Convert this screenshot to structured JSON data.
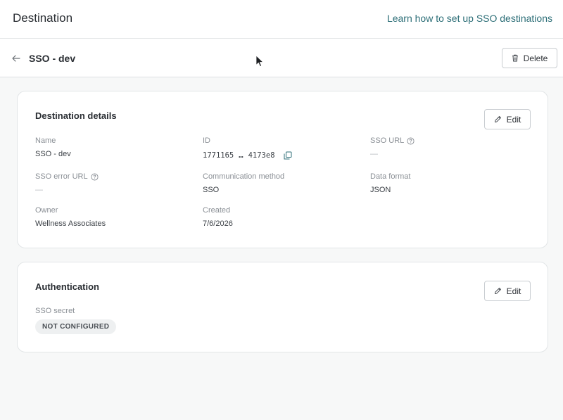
{
  "header": {
    "title": "Destination",
    "learn_link": "Learn how to set up SSO destinations"
  },
  "subheader": {
    "name": "SSO - dev",
    "delete_label": "Delete"
  },
  "details": {
    "title": "Destination details",
    "edit_label": "Edit",
    "fields": {
      "name": {
        "label": "Name",
        "value": "SSO - dev"
      },
      "id": {
        "label": "ID",
        "value_start": "1771165",
        "ellipsis": "…",
        "value_end": "4173e8"
      },
      "sso_url": {
        "label": "SSO URL",
        "value": "—"
      },
      "sso_error_url": {
        "label": "SSO error URL",
        "value": "—"
      },
      "communication_method": {
        "label": "Communication method",
        "value": "SSO"
      },
      "data_format": {
        "label": "Data format",
        "value": "JSON"
      },
      "owner": {
        "label": "Owner",
        "value": "Wellness Associates"
      },
      "created": {
        "label": "Created",
        "value": "7/6/2026"
      }
    }
  },
  "authentication": {
    "title": "Authentication",
    "edit_label": "Edit",
    "sso_secret": {
      "label": "SSO secret",
      "status": "NOT CONFIGURED"
    }
  },
  "colors": {
    "link": "#2c6e77",
    "background": "#f7f8f8",
    "card": "#ffffff",
    "border": "#e2e5e7",
    "muted_text": "#8a8f95"
  },
  "icons": [
    "arrow-left-icon",
    "trash-icon",
    "pencil-icon",
    "help-circle-icon",
    "copy-icon",
    "mouse-cursor-icon"
  ]
}
